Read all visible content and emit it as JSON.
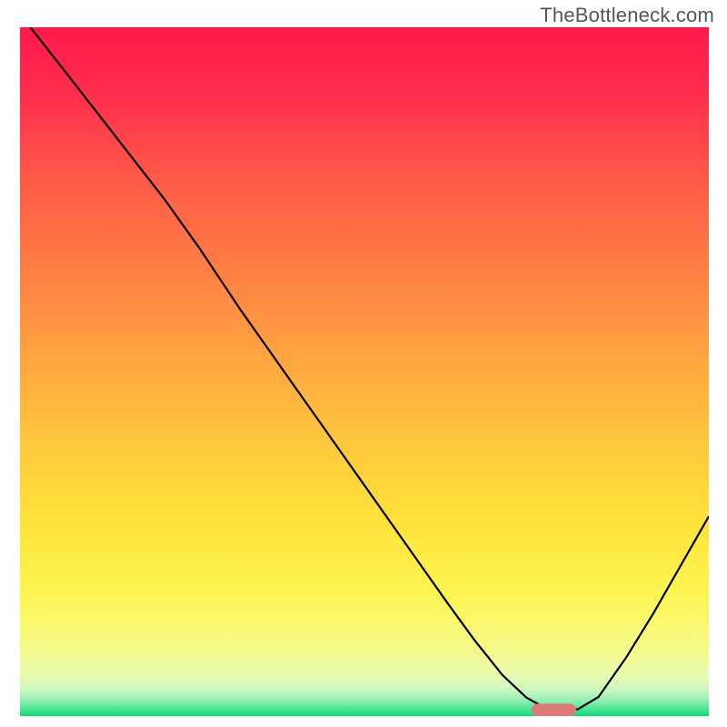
{
  "watermark": "TheBottleneck.com",
  "chart_data": {
    "type": "line",
    "title": "",
    "xlabel": "",
    "ylabel": "",
    "xlim": [
      0,
      100
    ],
    "ylim": [
      0,
      100
    ],
    "grid": false,
    "legend": false,
    "background": {
      "type": "vertical-gradient",
      "stops": [
        {
          "offset": 0.0,
          "color": "#ff1a4b"
        },
        {
          "offset": 0.1,
          "color": "#ff2e4d"
        },
        {
          "offset": 0.22,
          "color": "#ff5a48"
        },
        {
          "offset": 0.35,
          "color": "#ff7e45"
        },
        {
          "offset": 0.48,
          "color": "#ffa540"
        },
        {
          "offset": 0.6,
          "color": "#ffc73d"
        },
        {
          "offset": 0.72,
          "color": "#ffe33b"
        },
        {
          "offset": 0.82,
          "color": "#fdf451"
        },
        {
          "offset": 0.9,
          "color": "#f6fb87"
        },
        {
          "offset": 0.945,
          "color": "#e6fbb4"
        },
        {
          "offset": 0.965,
          "color": "#c3f6c0"
        },
        {
          "offset": 0.98,
          "color": "#86ecae"
        },
        {
          "offset": 0.992,
          "color": "#3de28f"
        },
        {
          "offset": 1.0,
          "color": "#12d877"
        }
      ]
    },
    "series": [
      {
        "name": "bottleneck-curve",
        "stroke": "#000000",
        "stroke_width": 2.2,
        "x": [
          1.5,
          7,
          14,
          21,
          26,
          32,
          38,
          44,
          50,
          56,
          62,
          66,
          70,
          73.5,
          76,
          79,
          81,
          84,
          88,
          92,
          96,
          100
        ],
        "y": [
          100,
          93,
          84,
          75,
          68,
          59,
          50.5,
          42,
          33.5,
          25,
          16.5,
          11,
          6,
          2.7,
          1.3,
          0.9,
          1.0,
          2.8,
          8.5,
          15,
          22,
          29
        ]
      }
    ],
    "marker": {
      "name": "optimal-range",
      "shape": "rounded-rect",
      "color": "#dd7b78",
      "x_center": 77.5,
      "y_center": 0.9,
      "width": 6.5,
      "height": 1.8
    }
  }
}
